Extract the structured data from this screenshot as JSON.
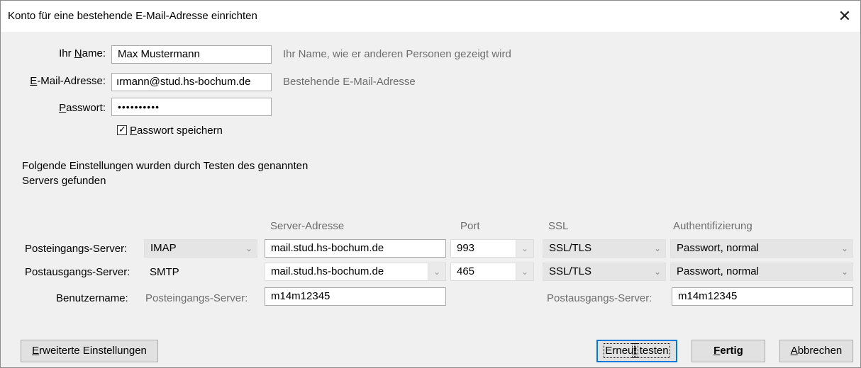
{
  "dialog": {
    "title": "Konto für eine bestehende E-Mail-Adresse einrichten",
    "close_glyph": "✕"
  },
  "identity": {
    "name_label_prefix": "Ihr ",
    "name_label_underlined": "N",
    "name_label_suffix": "ame:",
    "name_value": "Max Mustermann",
    "name_hint": "Ihr Name, wie er anderen Personen gezeigt wird",
    "email_label_underlined": "E",
    "email_label_suffix": "-Mail-Adresse:",
    "email_value": "ırmann@stud.hs-bochum.de",
    "email_hint": "Bestehende E-Mail-Adresse",
    "password_label_underlined": "P",
    "password_label_suffix": "asswort:",
    "password_value": "••••••••••",
    "remember_label_underlined": "P",
    "remember_label_suffix": "asswort speichern",
    "remember_checked": true,
    "check_glyph": "✓"
  },
  "found_message_line1": "Folgende Einstellungen wurden durch Testen des genannten",
  "found_message_line2": "Servers gefunden",
  "headers": {
    "server": "Server-Adresse",
    "port": "Port",
    "ssl": "SSL",
    "auth": "Authentifizierung"
  },
  "incoming": {
    "label": "Posteingangs-Server:",
    "protocol": "IMAP",
    "server": "mail.stud.hs-bochum.de",
    "port": "993",
    "ssl": "SSL/TLS",
    "auth": "Passwort, normal"
  },
  "outgoing": {
    "label": "Postausgangs-Server:",
    "protocol": "SMTP",
    "server": "mail.stud.hs-bochum.de",
    "port": "465",
    "ssl": "SSL/TLS",
    "auth": "Passwort, normal"
  },
  "username": {
    "label": "Benutzername:",
    "incoming_label": "Posteingangs-Server:",
    "incoming_value": "m14m12345",
    "outgoing_label": "Postausgangs-Server:",
    "outgoing_value": "m14m12345"
  },
  "buttons": {
    "advanced_underlined": "E",
    "advanced_suffix": "rweiterte Einstellungen",
    "retest_prefix": "Erneu",
    "retest_underlined": "t",
    "retest_suffix": " testen",
    "done_underlined": "F",
    "done_suffix": "ertig",
    "cancel_underlined": "A",
    "cancel_suffix": "bbrechen"
  },
  "chevron_glyph": "⌄"
}
